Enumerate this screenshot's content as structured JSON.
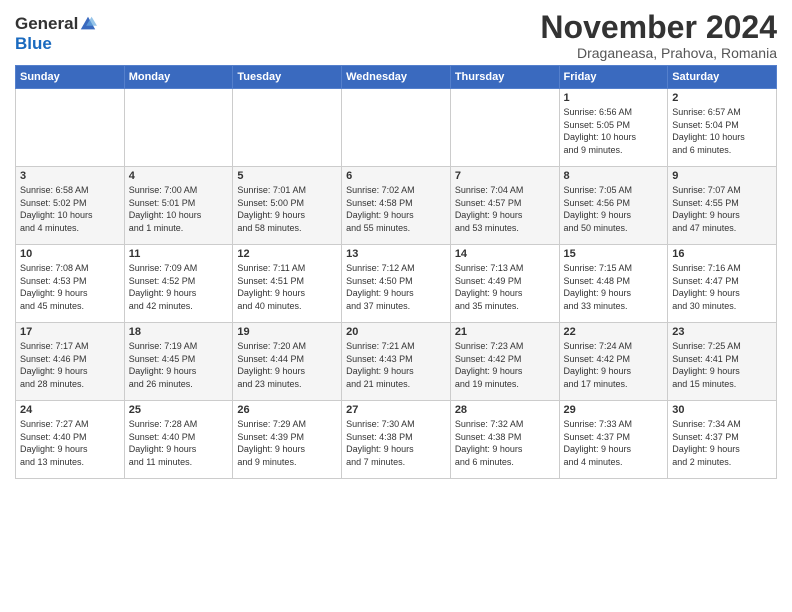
{
  "header": {
    "logo_general": "General",
    "logo_blue": "Blue",
    "month_title": "November 2024",
    "subtitle": "Draganeasa, Prahova, Romania"
  },
  "days_of_week": [
    "Sunday",
    "Monday",
    "Tuesday",
    "Wednesday",
    "Thursday",
    "Friday",
    "Saturday"
  ],
  "weeks": [
    [
      {
        "day": "",
        "info": ""
      },
      {
        "day": "",
        "info": ""
      },
      {
        "day": "",
        "info": ""
      },
      {
        "day": "",
        "info": ""
      },
      {
        "day": "",
        "info": ""
      },
      {
        "day": "1",
        "info": "Sunrise: 6:56 AM\nSunset: 5:05 PM\nDaylight: 10 hours\nand 9 minutes."
      },
      {
        "day": "2",
        "info": "Sunrise: 6:57 AM\nSunset: 5:04 PM\nDaylight: 10 hours\nand 6 minutes."
      }
    ],
    [
      {
        "day": "3",
        "info": "Sunrise: 6:58 AM\nSunset: 5:02 PM\nDaylight: 10 hours\nand 4 minutes."
      },
      {
        "day": "4",
        "info": "Sunrise: 7:00 AM\nSunset: 5:01 PM\nDaylight: 10 hours\nand 1 minute."
      },
      {
        "day": "5",
        "info": "Sunrise: 7:01 AM\nSunset: 5:00 PM\nDaylight: 9 hours\nand 58 minutes."
      },
      {
        "day": "6",
        "info": "Sunrise: 7:02 AM\nSunset: 4:58 PM\nDaylight: 9 hours\nand 55 minutes."
      },
      {
        "day": "7",
        "info": "Sunrise: 7:04 AM\nSunset: 4:57 PM\nDaylight: 9 hours\nand 53 minutes."
      },
      {
        "day": "8",
        "info": "Sunrise: 7:05 AM\nSunset: 4:56 PM\nDaylight: 9 hours\nand 50 minutes."
      },
      {
        "day": "9",
        "info": "Sunrise: 7:07 AM\nSunset: 4:55 PM\nDaylight: 9 hours\nand 47 minutes."
      }
    ],
    [
      {
        "day": "10",
        "info": "Sunrise: 7:08 AM\nSunset: 4:53 PM\nDaylight: 9 hours\nand 45 minutes."
      },
      {
        "day": "11",
        "info": "Sunrise: 7:09 AM\nSunset: 4:52 PM\nDaylight: 9 hours\nand 42 minutes."
      },
      {
        "day": "12",
        "info": "Sunrise: 7:11 AM\nSunset: 4:51 PM\nDaylight: 9 hours\nand 40 minutes."
      },
      {
        "day": "13",
        "info": "Sunrise: 7:12 AM\nSunset: 4:50 PM\nDaylight: 9 hours\nand 37 minutes."
      },
      {
        "day": "14",
        "info": "Sunrise: 7:13 AM\nSunset: 4:49 PM\nDaylight: 9 hours\nand 35 minutes."
      },
      {
        "day": "15",
        "info": "Sunrise: 7:15 AM\nSunset: 4:48 PM\nDaylight: 9 hours\nand 33 minutes."
      },
      {
        "day": "16",
        "info": "Sunrise: 7:16 AM\nSunset: 4:47 PM\nDaylight: 9 hours\nand 30 minutes."
      }
    ],
    [
      {
        "day": "17",
        "info": "Sunrise: 7:17 AM\nSunset: 4:46 PM\nDaylight: 9 hours\nand 28 minutes."
      },
      {
        "day": "18",
        "info": "Sunrise: 7:19 AM\nSunset: 4:45 PM\nDaylight: 9 hours\nand 26 minutes."
      },
      {
        "day": "19",
        "info": "Sunrise: 7:20 AM\nSunset: 4:44 PM\nDaylight: 9 hours\nand 23 minutes."
      },
      {
        "day": "20",
        "info": "Sunrise: 7:21 AM\nSunset: 4:43 PM\nDaylight: 9 hours\nand 21 minutes."
      },
      {
        "day": "21",
        "info": "Sunrise: 7:23 AM\nSunset: 4:42 PM\nDaylight: 9 hours\nand 19 minutes."
      },
      {
        "day": "22",
        "info": "Sunrise: 7:24 AM\nSunset: 4:42 PM\nDaylight: 9 hours\nand 17 minutes."
      },
      {
        "day": "23",
        "info": "Sunrise: 7:25 AM\nSunset: 4:41 PM\nDaylight: 9 hours\nand 15 minutes."
      }
    ],
    [
      {
        "day": "24",
        "info": "Sunrise: 7:27 AM\nSunset: 4:40 PM\nDaylight: 9 hours\nand 13 minutes."
      },
      {
        "day": "25",
        "info": "Sunrise: 7:28 AM\nSunset: 4:40 PM\nDaylight: 9 hours\nand 11 minutes."
      },
      {
        "day": "26",
        "info": "Sunrise: 7:29 AM\nSunset: 4:39 PM\nDaylight: 9 hours\nand 9 minutes."
      },
      {
        "day": "27",
        "info": "Sunrise: 7:30 AM\nSunset: 4:38 PM\nDaylight: 9 hours\nand 7 minutes."
      },
      {
        "day": "28",
        "info": "Sunrise: 7:32 AM\nSunset: 4:38 PM\nDaylight: 9 hours\nand 6 minutes."
      },
      {
        "day": "29",
        "info": "Sunrise: 7:33 AM\nSunset: 4:37 PM\nDaylight: 9 hours\nand 4 minutes."
      },
      {
        "day": "30",
        "info": "Sunrise: 7:34 AM\nSunset: 4:37 PM\nDaylight: 9 hours\nand 2 minutes."
      }
    ]
  ]
}
